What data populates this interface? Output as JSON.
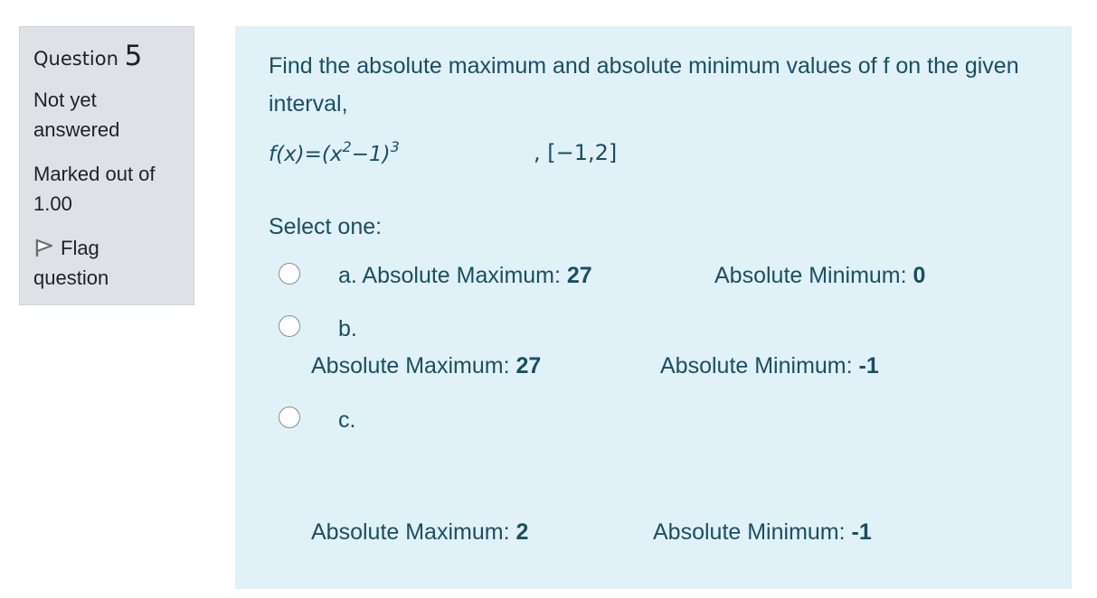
{
  "info": {
    "question_label": "Question",
    "question_number": "5",
    "state_line1": "Not yet",
    "state_line2": "answered",
    "grade_line1": "Marked out of",
    "grade_line2": "1.00",
    "flag_line1": "Flag",
    "flag_line2": "question",
    "flag_icon": "flag-icon"
  },
  "question": {
    "text": "Find the absolute maximum and absolute minimum values of f on the given interval,",
    "formula_left": "f(x)=(x",
    "formula_exp1": "2",
    "formula_mid": "−1)",
    "formula_exp2": "3",
    "interval": ", [−1,2]",
    "prompt": "Select one:"
  },
  "options": [
    {
      "letter": "a. ",
      "max_label": "Absolute Maximum: ",
      "max_value": "27",
      "min_label": "Absolute Minimum: ",
      "min_value": "0"
    },
    {
      "letter": "b.",
      "max_label": "Absolute Maximum: ",
      "max_value": "27",
      "min_label": "Absolute Minimum: ",
      "min_value": "-1"
    },
    {
      "letter": "c.",
      "max_label": "Absolute Maximum: ",
      "max_value": "2",
      "min_label": "Absolute Minimum: ",
      "min_value": "-1"
    }
  ],
  "colors": {
    "content_bg": "#e0f1f8",
    "info_bg": "#dee2e6",
    "text_blue": "#1b4e63"
  }
}
